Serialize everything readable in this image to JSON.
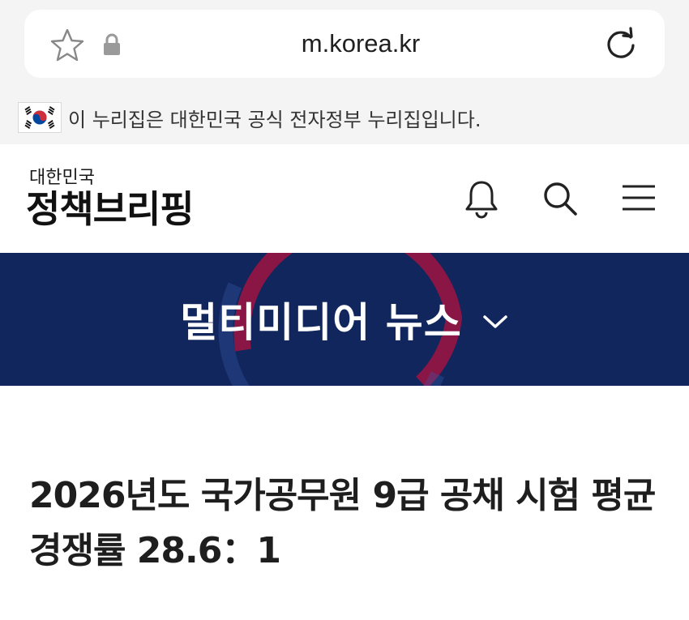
{
  "browser": {
    "url": "m.korea.kr",
    "icons": [
      "star-icon",
      "lock-icon",
      "reload-icon"
    ]
  },
  "gov_notice": {
    "text": "이 누리집은 대한민국 공식 전자정부 누리집입니다."
  },
  "header": {
    "logo_sub": "대한민국",
    "logo_main": "정책브리핑",
    "icons": [
      "bell-icon",
      "search-icon",
      "menu-icon"
    ]
  },
  "hero": {
    "title": "멀티미디어 뉴스"
  },
  "article": {
    "title": "2026년도 국가공무원 9급 공채 시험 평균 경쟁률 28.6：1"
  },
  "colors": {
    "hero_bg": "#10265c",
    "accent_red": "#e6002d",
    "browser_bg": "#f4f4f4"
  }
}
